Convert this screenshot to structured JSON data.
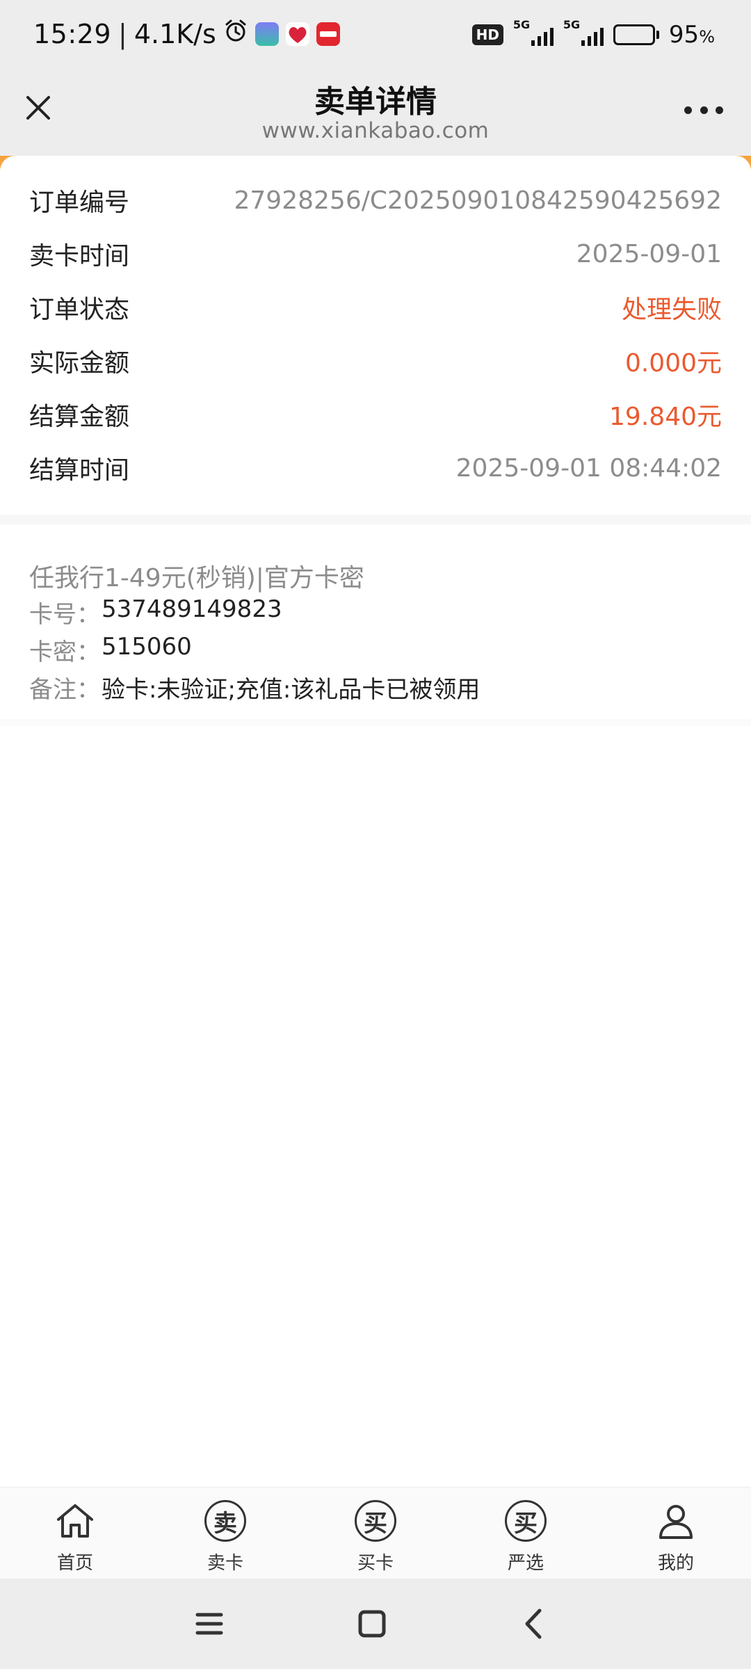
{
  "status_bar": {
    "time": "15:29",
    "net_speed": "4.1K/s",
    "hd_label": "HD",
    "sim1_net": "5G",
    "sim2_net": "5G",
    "battery_pct": "95",
    "battery_unit": "%"
  },
  "header": {
    "title": "卖单详情",
    "subtitle": "www.xiankabao.com"
  },
  "order": {
    "rows": [
      {
        "label": "订单编号",
        "value": "27928256/C202509010842590425692"
      },
      {
        "label": "卖卡时间",
        "value": "2025-09-01"
      },
      {
        "label": "订单状态",
        "value": "处理失败"
      },
      {
        "label": "实际金额",
        "value": "0.000元"
      },
      {
        "label": "结算金额",
        "value": "19.840元"
      },
      {
        "label": "结算时间",
        "value": "2025-09-01 08:44:02"
      }
    ]
  },
  "card": {
    "title": "任我行1-49元(秒销)|官方卡密",
    "number_label": "卡号：",
    "number": "537489149823",
    "secret_label": "卡密：",
    "secret": "515060",
    "note_label": "备注：",
    "note": "验卡:未验证;充值:该礼品卡已被领用"
  },
  "tabs": [
    {
      "label": "首页",
      "icon": "home-icon"
    },
    {
      "label": "卖卡",
      "icon": "sell-card-icon",
      "glyph": "卖"
    },
    {
      "label": "买卡",
      "icon": "buy-card-icon",
      "glyph": "买"
    },
    {
      "label": "严选",
      "icon": "curated-icon",
      "glyph": "买"
    },
    {
      "label": "我的",
      "icon": "profile-icon"
    }
  ],
  "colors": {
    "status_red": "#ea5a2f",
    "accent_orange": "#f7a340",
    "header_bg": "#ededed"
  }
}
